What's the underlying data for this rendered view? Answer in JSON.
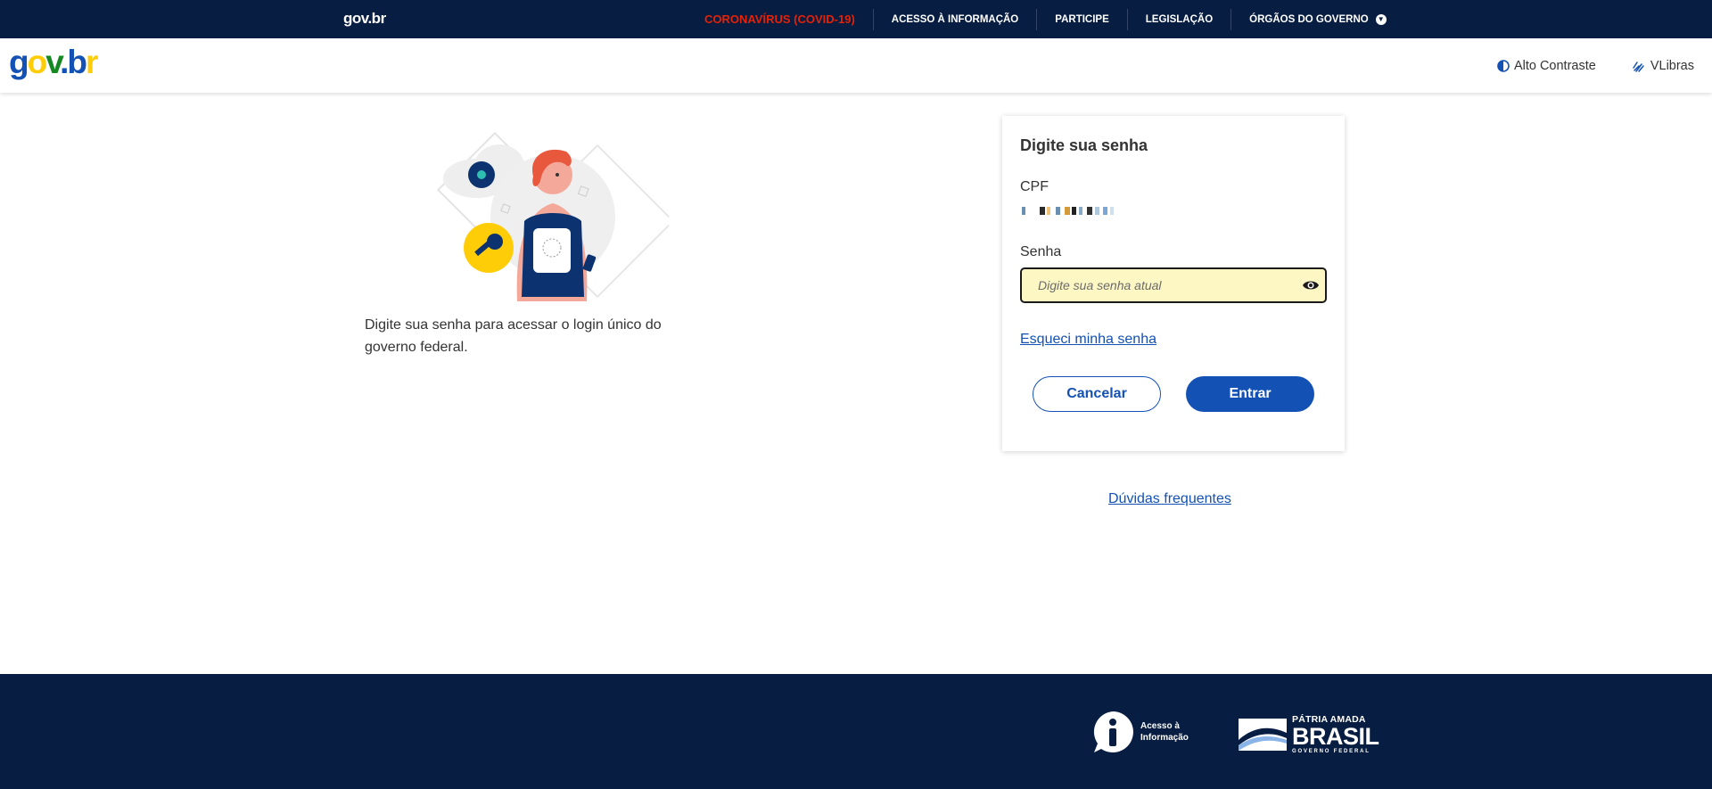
{
  "top_bar": {
    "logo_text": "gov.br",
    "nav": [
      {
        "label": "CORONAVÍRUS (COVID-19)"
      },
      {
        "label": "ACESSO À INFORMAÇÃO"
      },
      {
        "label": "PARTICIPE"
      },
      {
        "label": "LEGISLAÇÃO"
      },
      {
        "label": "ÓRGÃOS DO GOVERNO"
      }
    ],
    "colors": {
      "background": "#071d41",
      "covid": "#e52207"
    }
  },
  "header": {
    "logo": "gov.br",
    "high_contrast_label": "Alto Contraste",
    "vlibras_label": "VLibras"
  },
  "intro": {
    "text": "Digite sua senha para acessar o login único do governo federal."
  },
  "login_card": {
    "title": "Digite sua senha",
    "cpf_label": "CPF",
    "senha_label": "Senha",
    "senha_placeholder": "Digite sua senha atual",
    "senha_value": "",
    "forgot_link": "Esqueci minha senha",
    "cancel_button": "Cancelar",
    "enter_button": "Entrar",
    "colors": {
      "primary": "#1351b4",
      "input_bg": "#fdf7c4"
    }
  },
  "faq_link": "Dúvidas frequentes",
  "footer": {
    "info_text": "Acesso à\nInformação",
    "brasil_top": "PÁTRIA AMADA",
    "brasil_main": "BRASIL",
    "brasil_sub": "GOVERNO FEDERAL"
  }
}
